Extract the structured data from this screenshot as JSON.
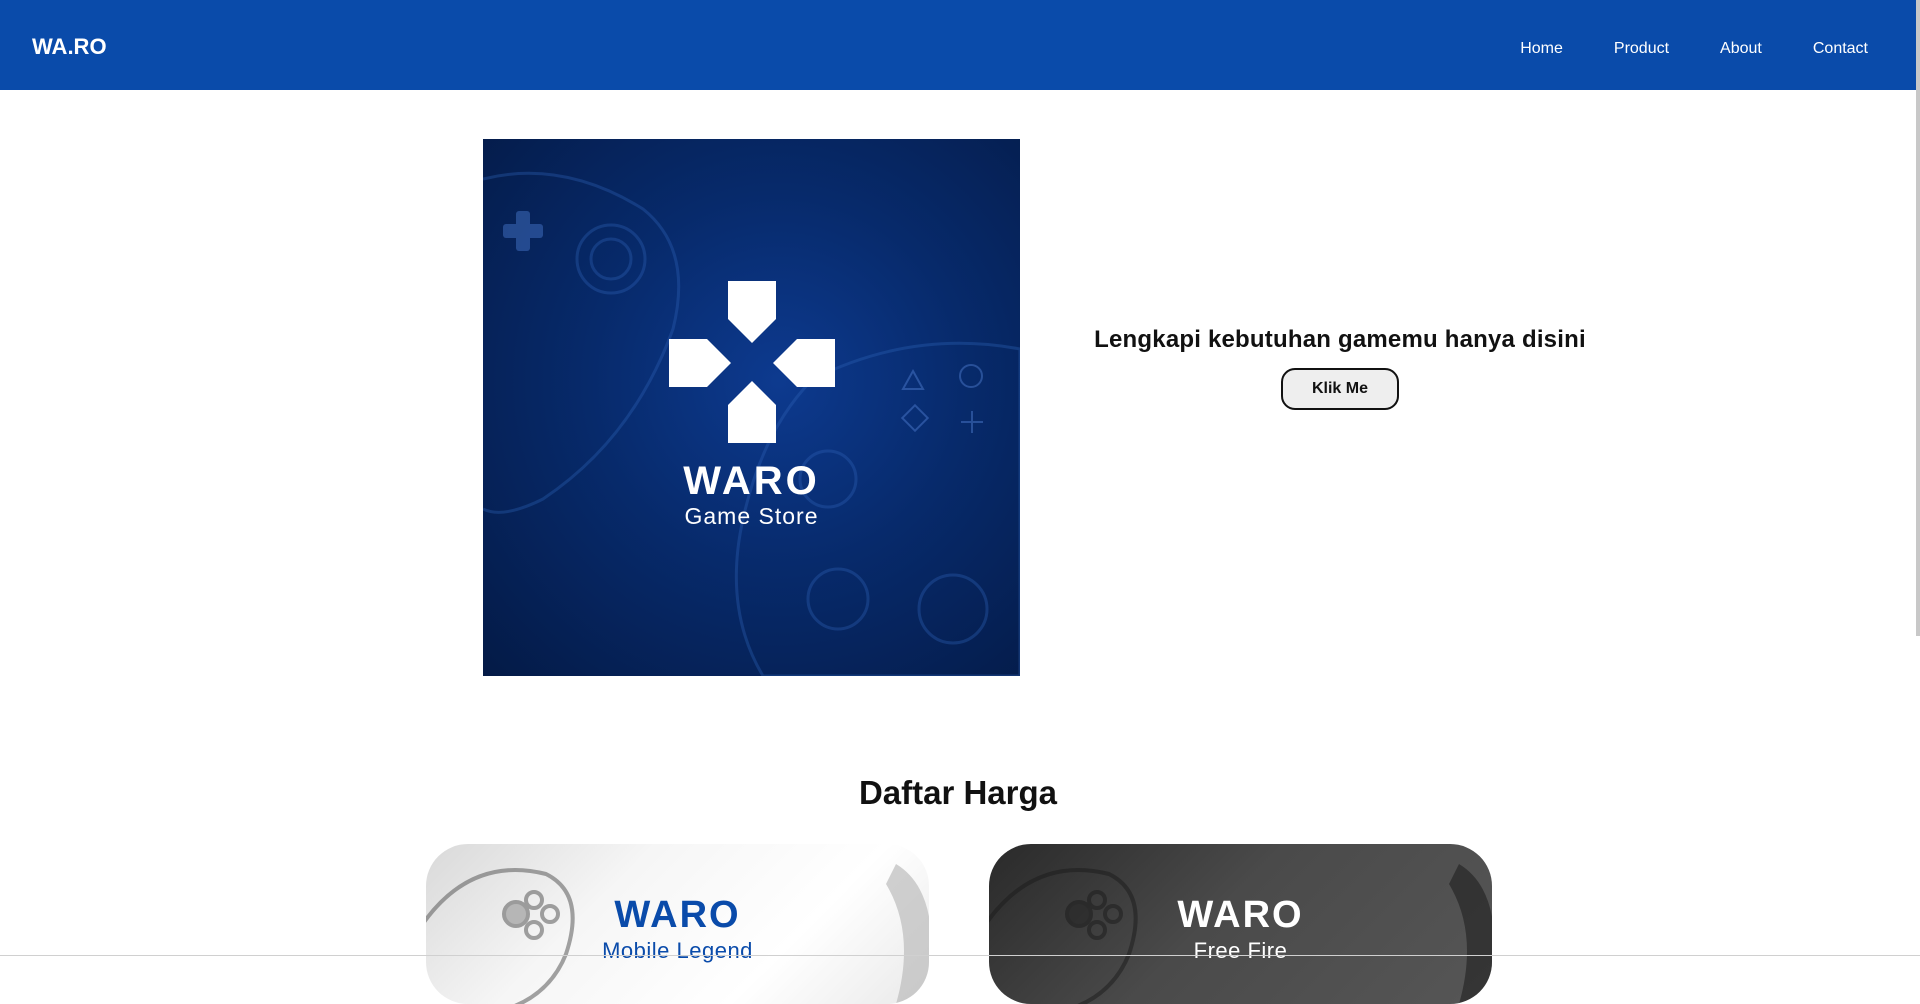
{
  "navbar": {
    "logo": "WA.RO",
    "links": [
      "Home",
      "Product",
      "About",
      "Contact"
    ],
    "background": "#0a4baa"
  },
  "hero": {
    "image": {
      "brand": "WARO",
      "tagline": "Game Store",
      "icon": "dpad-cross-icon"
    },
    "heading": "Lengkapi kebutuhan gamemu hanya disini",
    "button_label": "Klik Me"
  },
  "pricing": {
    "title": "Daftar Harga",
    "cards": [
      {
        "brand": "WARO",
        "subtitle": "Mobile Legend",
        "theme": "light",
        "icon": "gamepad-icon"
      },
      {
        "brand": "WARO",
        "subtitle": "Free Fire",
        "theme": "dark",
        "icon": "gamepad-icon"
      }
    ]
  }
}
